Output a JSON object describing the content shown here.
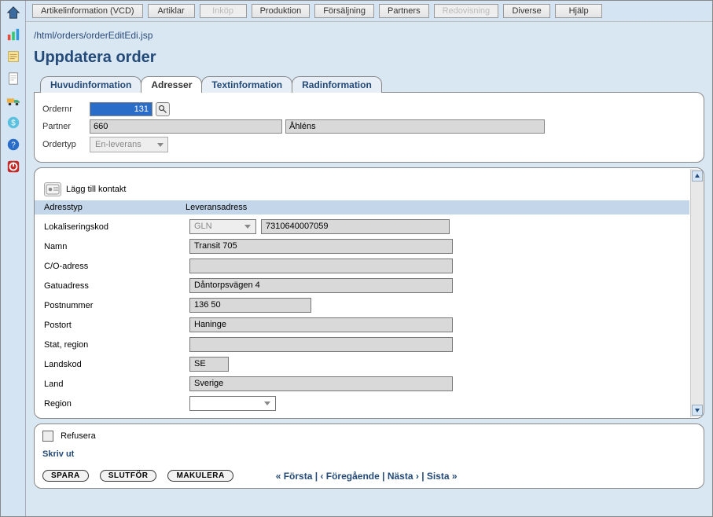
{
  "menu": {
    "items": [
      {
        "label": "Artikelinformation (VCD)",
        "disabled": false
      },
      {
        "label": "Artiklar",
        "disabled": false
      },
      {
        "label": "Inköp",
        "disabled": true
      },
      {
        "label": "Produktion",
        "disabled": false
      },
      {
        "label": "Försäljning",
        "disabled": false
      },
      {
        "label": "Partners",
        "disabled": false
      },
      {
        "label": "Redovisning",
        "disabled": true
      },
      {
        "label": "Diverse",
        "disabled": false
      },
      {
        "label": "Hjälp",
        "disabled": false
      }
    ]
  },
  "path": "/html/orders/orderEditEdi.jsp",
  "title": "Uppdatera order",
  "tabs": [
    {
      "label": "Huvudinformation"
    },
    {
      "label": "Adresser"
    },
    {
      "label": "Textinformation"
    },
    {
      "label": "Radinformation"
    }
  ],
  "header_form": {
    "ordernr_label": "Ordernr",
    "ordernr_value": "131",
    "partner_label": "Partner",
    "partner_code": "660",
    "partner_name": "Åhléns",
    "ordertyp_label": "Ordertyp",
    "ordertyp_value": "En-leverans"
  },
  "contact_section": {
    "add_label": "Lägg till kontakt",
    "col1": "Adresstyp",
    "col2": "Leveransadress"
  },
  "address": {
    "lokaliseringskod_label": "Lokaliseringskod",
    "lokaliseringskod_type": "GLN",
    "lokaliseringskod_value": "7310640007059",
    "namn_label": "Namn",
    "namn_value": "Transit 705",
    "co_label": "C/O-adress",
    "co_value": "",
    "gatu_label": "Gatuadress",
    "gatu_value": "Dåntorpsvägen 4",
    "postnr_label": "Postnummer",
    "postnr_value": "136 50",
    "postort_label": "Postort",
    "postort_value": "Haninge",
    "stat_label": "Stat, region",
    "stat_value": "",
    "landskod_label": "Landskod",
    "landskod_value": "SE",
    "land_label": "Land",
    "land_value": "Sverige",
    "region_label": "Region",
    "region_value": ""
  },
  "footer": {
    "refusera_label": "Refusera",
    "skrivut_label": "Skriv ut",
    "spara": "SPARA",
    "slutfor": "SLUTFÖR",
    "makulera": "MAKULERA",
    "pager_first": "« Första",
    "pager_prev": "‹ Föregående",
    "pager_next": "Nästa ›",
    "pager_last": "Sista »",
    "pager_sep": " | "
  }
}
